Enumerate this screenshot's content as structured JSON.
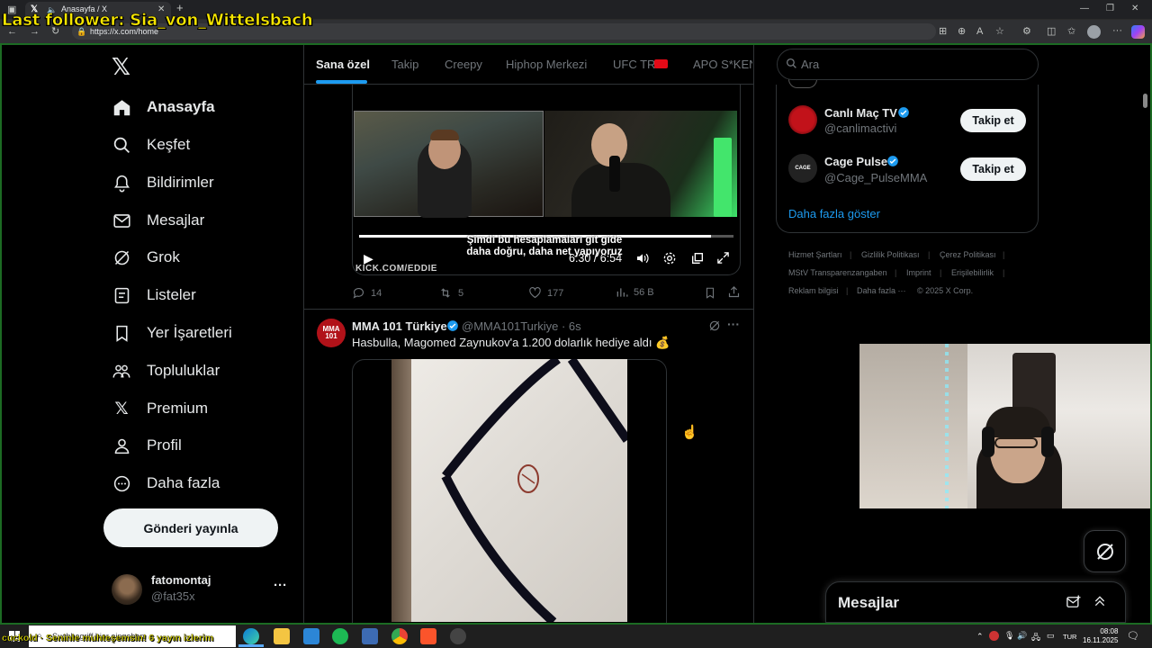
{
  "browser": {
    "tab_title": "Anasayfa / X",
    "url": "https://x.com/home"
  },
  "stream_overlay": {
    "last_follower": "Last follower: Sia_von_Wittelsbach",
    "ticker": "cuckold · Seninle muhteşemsin! 6 yayın izlerim"
  },
  "nav": {
    "logo": "𝕏",
    "items": [
      {
        "label": "Anasayfa",
        "icon": "home-icon",
        "active": true
      },
      {
        "label": "Keşfet",
        "icon": "search-icon"
      },
      {
        "label": "Bildirimler",
        "icon": "bell-icon"
      },
      {
        "label": "Mesajlar",
        "icon": "mail-icon"
      },
      {
        "label": "Grok",
        "icon": "grok-icon"
      },
      {
        "label": "Listeler",
        "icon": "list-icon"
      },
      {
        "label": "Yer İşaretleri",
        "icon": "bookmark-icon"
      },
      {
        "label": "Topluluklar",
        "icon": "communities-icon"
      },
      {
        "label": "Premium",
        "icon": "x-icon"
      },
      {
        "label": "Profil",
        "icon": "profile-icon"
      },
      {
        "label": "Daha fazla",
        "icon": "more-circle-icon"
      }
    ],
    "post_button": "Gönderi yayınla",
    "account": {
      "name": "fatomontaj",
      "handle": "@fat35x",
      "more": "···"
    }
  },
  "feed_tabs": [
    "Sana özel",
    "Takip",
    "Creepy",
    "Hiphop Merkezi",
    "UFC TR",
    "APO S*KEN"
  ],
  "tweet1": {
    "subtitle_line1": "Şimdi bu hesaplamaları git gide",
    "subtitle_line2": "daha doğru, daha net yapıyoruz",
    "watermark": "KICK.COM/EDDIE",
    "video_time": "6:30 / 6:54",
    "progress": 0.94,
    "replies": "14",
    "reposts": "5",
    "likes": "177",
    "views": "56 B"
  },
  "tweet2": {
    "avatar_text": "MMA 101",
    "name": "MMA 101 Türkiye",
    "handle_time": "@MMA101Turkiye · 6s",
    "text": "Hasbulla, Magomed Zaynukov'a 1.200 dolarlık hediye aldı 💰"
  },
  "right": {
    "search_placeholder": "Ara",
    "suggestions": [
      {
        "name": "Canlı Maç TV",
        "handle": "@canlimactivi",
        "button": "Takip et"
      },
      {
        "name": "Cage Pulse",
        "handle": "@Cage_PulseMMA",
        "button": "Takip et"
      }
    ],
    "show_more": "Daha fazla göster",
    "footer": [
      "Hizmet Şartları",
      "Gizlilik Politikası",
      "Çerez Politikası",
      "MStV Transparenzangaben",
      "Imprint",
      "Erişilebilirlik",
      "Reklam bilgisi",
      "Daha fazla ···",
      "© 2025 X Corp."
    ]
  },
  "messages_drawer": {
    "title": "Mesajlar"
  },
  "taskbar": {
    "search_placeholder": "Suchbegriff hier eingeben",
    "lang": "TUR",
    "time": "08:08",
    "date": "16.11.2025"
  },
  "colors": {
    "accent": "#1d9bf0",
    "overlay_yellow": "#f5e500",
    "stream_border": "#1c6b23"
  }
}
